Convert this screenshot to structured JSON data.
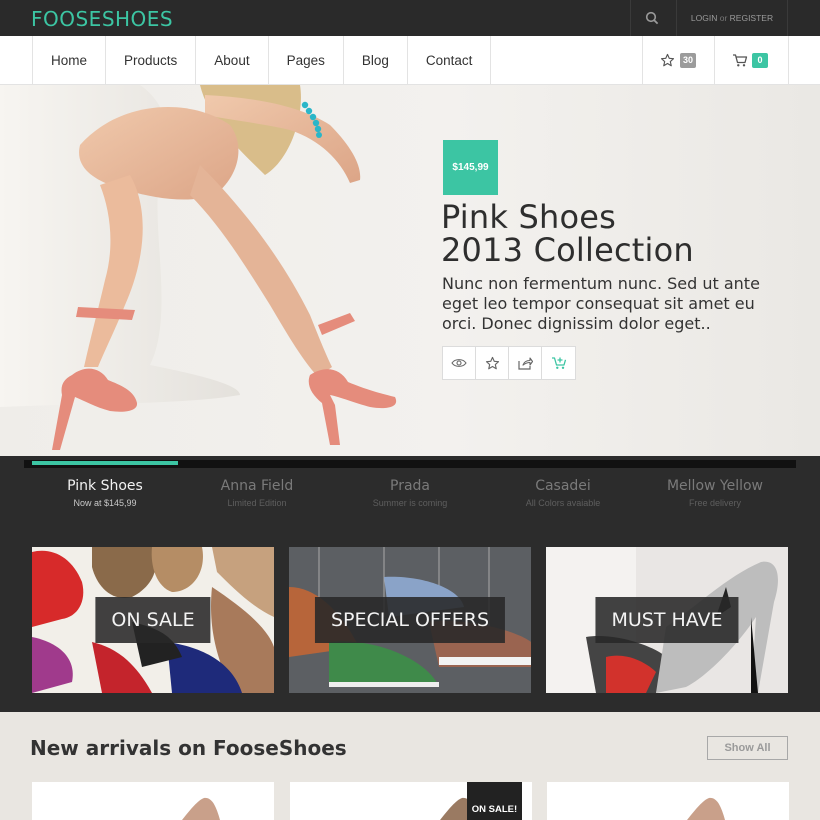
{
  "brand": {
    "logo": "FOOSESHOES",
    "accent": "#3cc5a3"
  },
  "topbar": {
    "login": "LOGIN",
    "or": "or",
    "register": "REGISTER"
  },
  "nav": {
    "items": [
      "Home",
      "Products",
      "About",
      "Pages",
      "Blog",
      "Contact"
    ],
    "favorites_count": "30",
    "cart_count": "0"
  },
  "hero": {
    "price": "$145,99",
    "title_line1": "Pink Shoes",
    "title_line2": "2013 Collection",
    "text": "Nunc non fermentum nunc. Sed ut ante eget leo tempor consequat sit amet eu orci. Donec dignissim dolor eget..",
    "actions": [
      "eye-icon",
      "star-icon",
      "share-icon",
      "cart-plus-icon"
    ]
  },
  "slider_tabs": [
    {
      "name": "Pink Shoes",
      "sub": "Now at $145,99",
      "active": true
    },
    {
      "name": "Anna Field",
      "sub": "Limited Edition",
      "active": false
    },
    {
      "name": "Prada",
      "sub": "Summer is coming",
      "active": false
    },
    {
      "name": "Casadei",
      "sub": "All Colors avaiable",
      "active": false
    },
    {
      "name": "Mellow Yellow",
      "sub": "Free delivery",
      "active": false
    }
  ],
  "promos": [
    {
      "label": "ON SALE"
    },
    {
      "label": "SPECIAL OFFERS"
    },
    {
      "label": "MUST HAVE"
    }
  ],
  "arrivals": {
    "title": "New arrivals on FooseShoes",
    "show_all": "Show All",
    "sale_badge": "ON SALE!"
  }
}
